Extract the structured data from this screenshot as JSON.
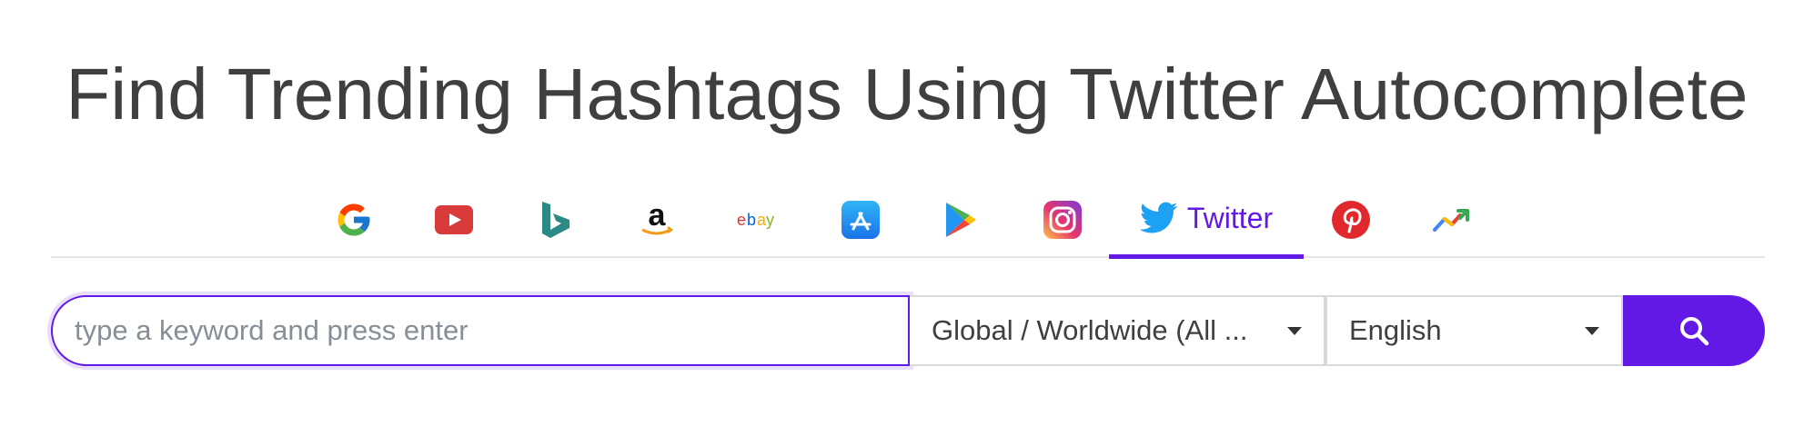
{
  "page": {
    "title": "Find Trending Hashtags Using Twitter Autocomplete"
  },
  "tabs": [
    {
      "id": "google",
      "icon": "google-icon"
    },
    {
      "id": "youtube",
      "icon": "youtube-icon"
    },
    {
      "id": "bing",
      "icon": "bing-icon"
    },
    {
      "id": "amazon",
      "icon": "amazon-icon"
    },
    {
      "id": "ebay",
      "icon": "ebay-icon",
      "logo_text": "ebay"
    },
    {
      "id": "app-store",
      "icon": "app-store-icon"
    },
    {
      "id": "google-play",
      "icon": "google-play-icon"
    },
    {
      "id": "instagram",
      "icon": "instagram-icon"
    },
    {
      "id": "twitter",
      "icon": "twitter-icon",
      "label": "Twitter",
      "active": true
    },
    {
      "id": "pinterest",
      "icon": "pinterest-icon"
    },
    {
      "id": "trends",
      "icon": "trending-up-icon"
    }
  ],
  "search": {
    "value": "",
    "placeholder": "type a keyword and press enter",
    "region": "Global / Worldwide (All ...",
    "language": "English",
    "button_icon": "search-icon"
  },
  "colors": {
    "accent": "#6219e6",
    "title": "#3f3f3f",
    "border": "#d9d9d9"
  }
}
